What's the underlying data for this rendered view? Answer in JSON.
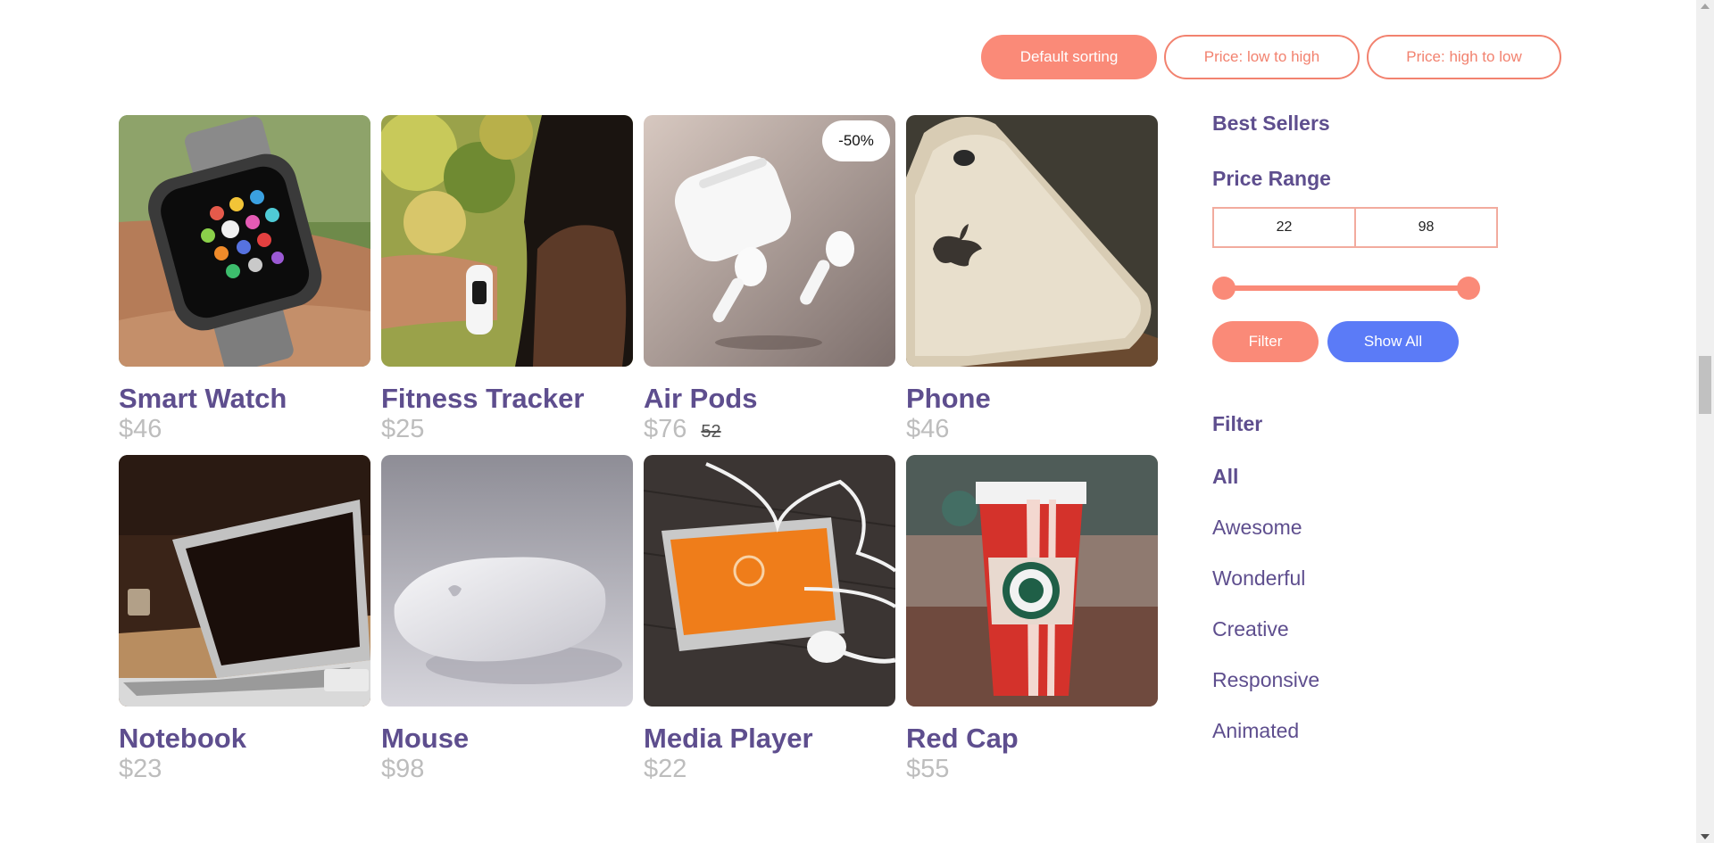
{
  "sorting": {
    "default": "Default sorting",
    "low_high": "Price: low to high",
    "high_low": "Price: high to low"
  },
  "products": [
    {
      "name": "Smart Watch",
      "price": "$46",
      "image": "smart-watch"
    },
    {
      "name": "Fitness Tracker",
      "price": "$25",
      "image": "fitness-tracker"
    },
    {
      "name": "Air Pods",
      "price": "$76",
      "old_price": "52",
      "badge": "-50%",
      "image": "air-pods"
    },
    {
      "name": "Phone",
      "price": "$46",
      "image": "phone"
    },
    {
      "name": "Notebook",
      "price": "$23",
      "image": "notebook"
    },
    {
      "name": "Mouse",
      "price": "$98",
      "image": "mouse"
    },
    {
      "name": "Media Player",
      "price": "$22",
      "image": "media-player"
    },
    {
      "name": "Red Cap",
      "price": "$55",
      "image": "red-cap"
    }
  ],
  "sidebar": {
    "best_sellers": "Best Sellers",
    "price_range": "Price Range",
    "min": "22",
    "max": "98",
    "filter_button": "Filter",
    "show_all_button": "Show All",
    "filter_heading": "Filter",
    "categories": [
      "All",
      "Awesome",
      "Wonderful",
      "Creative",
      "Responsive",
      "Animated"
    ]
  },
  "colors": {
    "accent": "#fa8a78",
    "title": "#5e4e8e",
    "blue": "#5b7bf7",
    "price": "#bdbdbd"
  }
}
